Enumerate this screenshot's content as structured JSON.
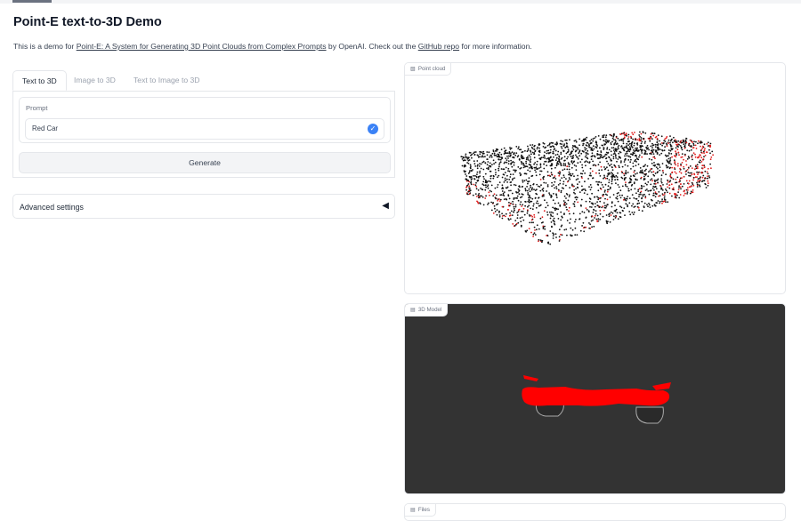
{
  "page": {
    "title": "Point-E text-to-3D Demo",
    "intro_prefix": "This is a demo for ",
    "intro_link1": "Point-E: A System for Generating 3D Point Clouds from Complex Prompts",
    "intro_middle": " by OpenAI. Check out the ",
    "intro_link2": "GitHub repo",
    "intro_suffix": " for more information."
  },
  "tabs": [
    {
      "label": "Text to 3D",
      "active": true
    },
    {
      "label": "Image to 3D",
      "active": false
    },
    {
      "label": "Text to Image to 3D",
      "active": false
    }
  ],
  "prompt": {
    "label": "Prompt",
    "value": "Red Car"
  },
  "generate_label": "Generate",
  "advanced_label": "Advanced settings",
  "advanced_arrow": "◀",
  "outputs": {
    "point_cloud_label": "Point cloud",
    "model_label": "3D Model",
    "files_label": "Files"
  },
  "colors": {
    "point_black": "#111111",
    "point_red": "#e11d1d",
    "model_bg": "#333333",
    "model_red": "#ff0000",
    "accent_check": "#3b82f6"
  }
}
